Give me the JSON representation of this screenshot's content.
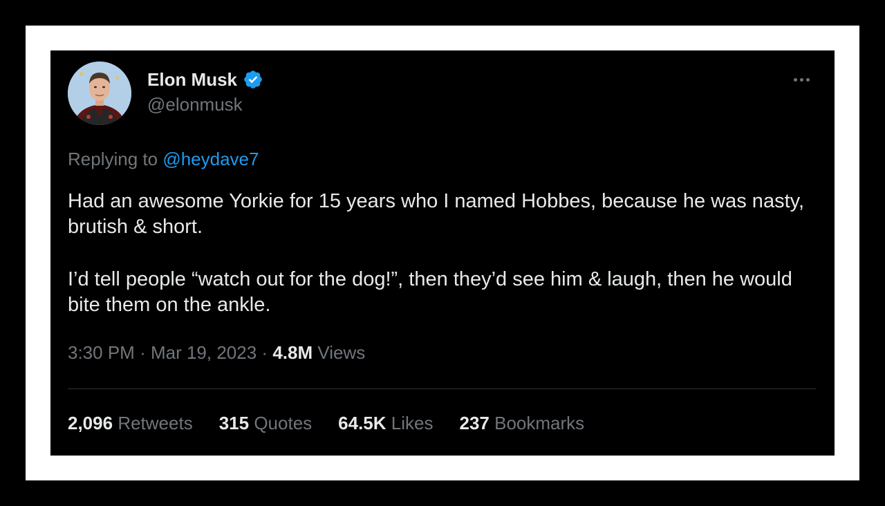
{
  "tweet": {
    "author": {
      "display_name": "Elon Musk",
      "handle": "@elonmusk",
      "verified": true
    },
    "reply": {
      "prefix": "Replying to",
      "mention": "@heydave7"
    },
    "body": [
      "Had an awesome Yorkie for 15 years who I named Hobbes, because he was nasty, brutish & short.",
      "I’d tell people “watch out for the dog!”, then they’d see him & laugh, then he would bite them on the ankle."
    ],
    "meta": {
      "time": "3:30 PM",
      "separator": "·",
      "date": "Mar 19, 2023",
      "views_count": "4.8M",
      "views_label": "Views"
    },
    "stats": [
      {
        "count": "2,096",
        "label": "Retweets"
      },
      {
        "count": "315",
        "label": "Quotes"
      },
      {
        "count": "64.5K",
        "label": "Likes"
      },
      {
        "count": "237",
        "label": "Bookmarks"
      }
    ]
  },
  "icons": {
    "verified": "verified-badge-icon",
    "more": "more-horizontal-icon"
  },
  "colors": {
    "background": "#000000",
    "frame": "#ffffff",
    "text_primary": "#e7e9ea",
    "text_secondary": "#71767b",
    "accent": "#1d9bf0",
    "divider": "#2f3336"
  }
}
